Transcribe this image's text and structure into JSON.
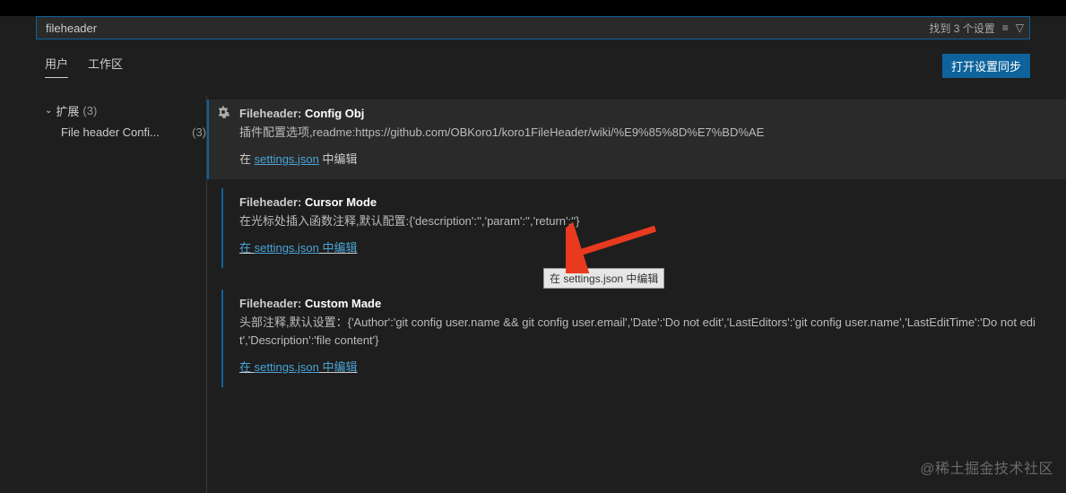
{
  "search": {
    "value": "fileheader"
  },
  "search_results": {
    "text": "找到 3 个设置"
  },
  "tabs": {
    "user": "用户",
    "workspace": "工作区"
  },
  "sync_button": "打开设置同步",
  "sidebar": {
    "group_label": "扩展",
    "group_count": "(3)",
    "child_label": "File header Confi...",
    "child_count": "(3)"
  },
  "settings": [
    {
      "prefix": "Fileheader:",
      "name": "Config Obj",
      "description": "插件配置选项,readme:https://github.com/OBKoro1/koro1FileHeader/wiki/%E9%85%8D%E7%BD%AE",
      "edit_pre": "在 ",
      "edit_link": "settings.json",
      "edit_post": " 中编辑",
      "highlight": true
    },
    {
      "prefix": "Fileheader:",
      "name": "Cursor Mode",
      "description": "在光标处插入函数注释,默认配置:{'description':'','param':'','return':''}",
      "edit_pre": "在 ",
      "edit_link": "settings.json",
      "edit_post": " 中编辑",
      "highlight": false
    },
    {
      "prefix": "Fileheader:",
      "name": "Custom Made",
      "description": "头部注释,默认设置：{'Author':'git config user.name && git config user.email','Date':'Do not edit','LastEditors':'git config user.name','LastEditTime':'Do not edit','Description':'file content'}",
      "edit_pre": "在 ",
      "edit_link": "settings.json",
      "edit_post": " 中编辑",
      "highlight": false
    }
  ],
  "tooltip": "在 settings.json 中编辑",
  "watermark": "@稀土掘金技术社区"
}
